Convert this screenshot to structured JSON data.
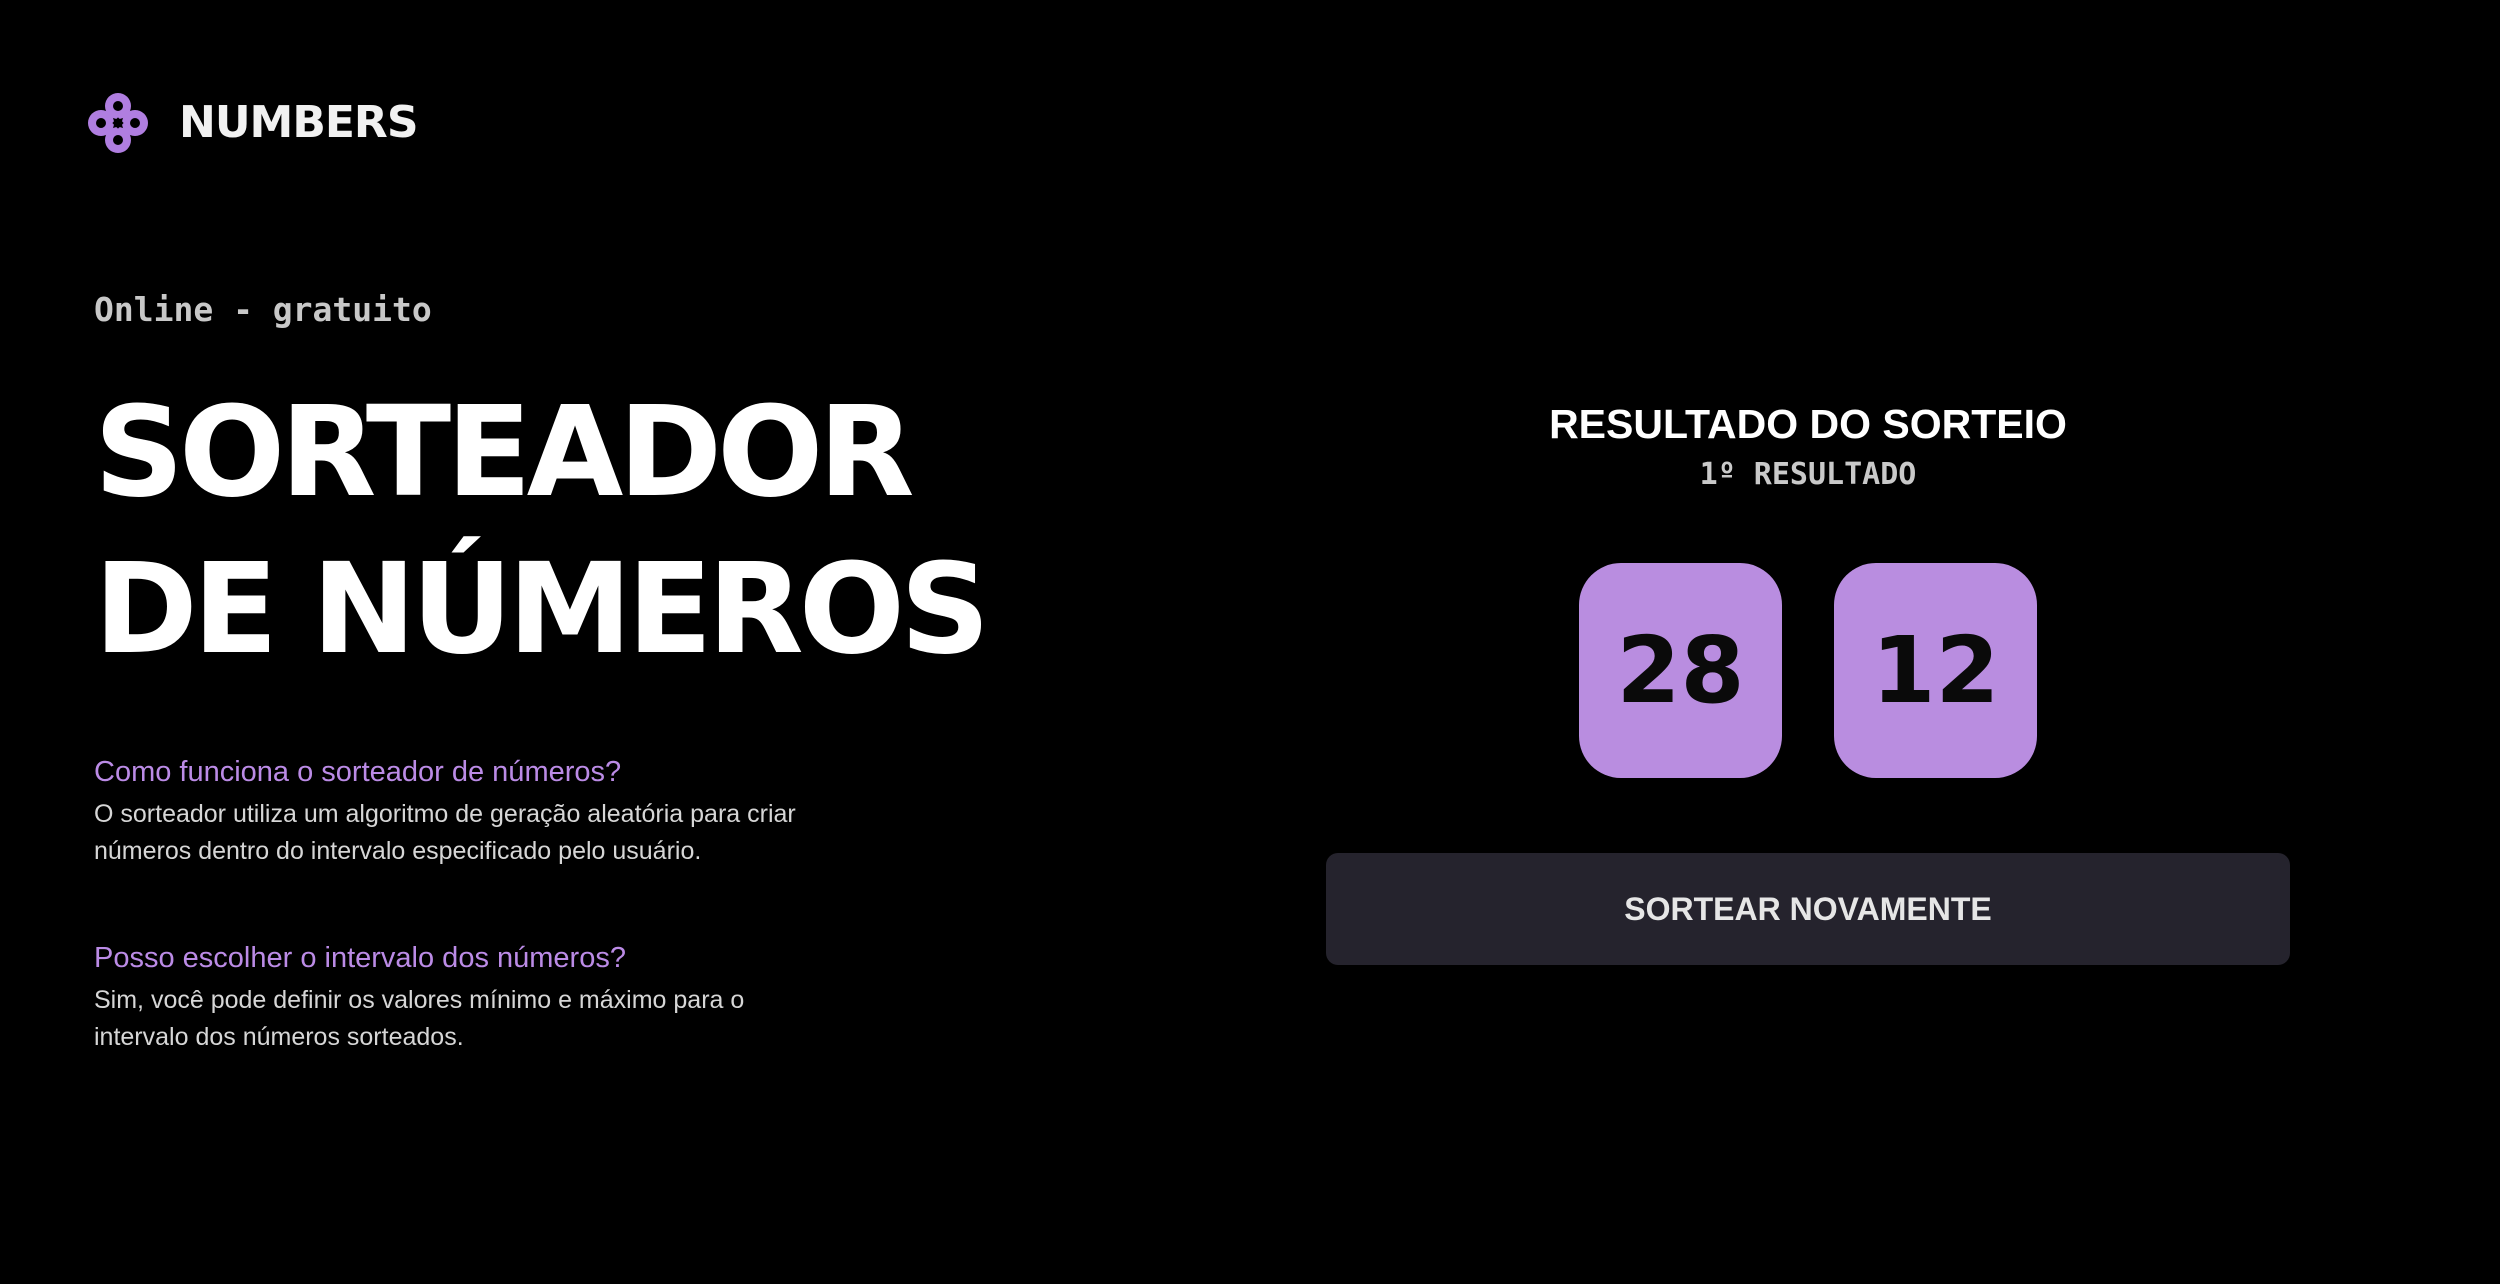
{
  "header": {
    "brand": "NUMBERS",
    "logo_icon": "clover-knot-icon",
    "accent_color": "#bb8be6"
  },
  "hero": {
    "eyebrow": "Online - gratuito",
    "title_line1": "SORTEADOR",
    "title_line2": "DE NÚMEROS"
  },
  "faq": [
    {
      "question": "Como funciona o sorteador de números?",
      "answer": "O sorteador utiliza um algoritmo de geração aleatória para criar números dentro do intervalo especificado pelo usuário."
    },
    {
      "question": "Posso escolher o intervalo dos números?",
      "answer": "Sim, você pode definir os valores mínimo e máximo para o intervalo dos números sorteados."
    }
  ],
  "result": {
    "title": "RESULTADO DO SORTEIO",
    "subtitle": "1º RESULTADO",
    "numbers": [
      "28",
      "12"
    ],
    "number_box_color": "#b98de0",
    "redraw_label": "SORTEAR NOVAMENTE",
    "button_color": "#25232d"
  }
}
